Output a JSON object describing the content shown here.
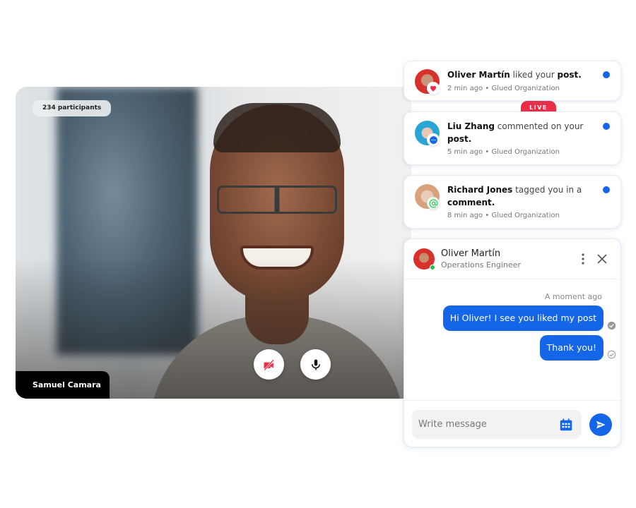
{
  "video": {
    "participants_label": "234 participants",
    "speaker_name": "Samuel Camara",
    "controls": {
      "camera": {
        "icon": "camera-off-icon",
        "state": "off",
        "color": "#ee2d47"
      },
      "microphone": {
        "icon": "microphone-icon",
        "state": "on"
      }
    },
    "live_badge": "LIVE"
  },
  "notifications": [
    {
      "actor": "Oliver Martín",
      "action": "liked your",
      "object": "post.",
      "time": "2 min ago",
      "separator": "•",
      "organization": "Glued Organization",
      "badge_icon": "heart-icon",
      "unread": true
    },
    {
      "actor": "Liu Zhang",
      "action": "commented on your",
      "object": "post.",
      "time": "5 min ago",
      "separator": "•",
      "organization": "Glued Organization",
      "badge_icon": "comment-icon",
      "unread": true
    },
    {
      "actor": "Richard Jones",
      "action": "tagged you in a",
      "object": "comment.",
      "time": "8 min ago",
      "separator": "•",
      "organization": "Glued Organization",
      "badge_icon": "at-mention-icon",
      "unread": true
    }
  ],
  "chat": {
    "contact_name": "Oliver Martín",
    "contact_role": "Operations Engineer",
    "online": true,
    "timestamp": "A moment ago",
    "messages": [
      {
        "text": "Hi Oliver! I see you liked my post",
        "status": "read"
      },
      {
        "text": "Thank you!",
        "status": "sent"
      }
    ],
    "input": {
      "value": "",
      "placeholder": "Write message"
    }
  },
  "colors": {
    "accent": "#1565e8",
    "live": "#ee2d47",
    "online": "#2ebd59"
  }
}
